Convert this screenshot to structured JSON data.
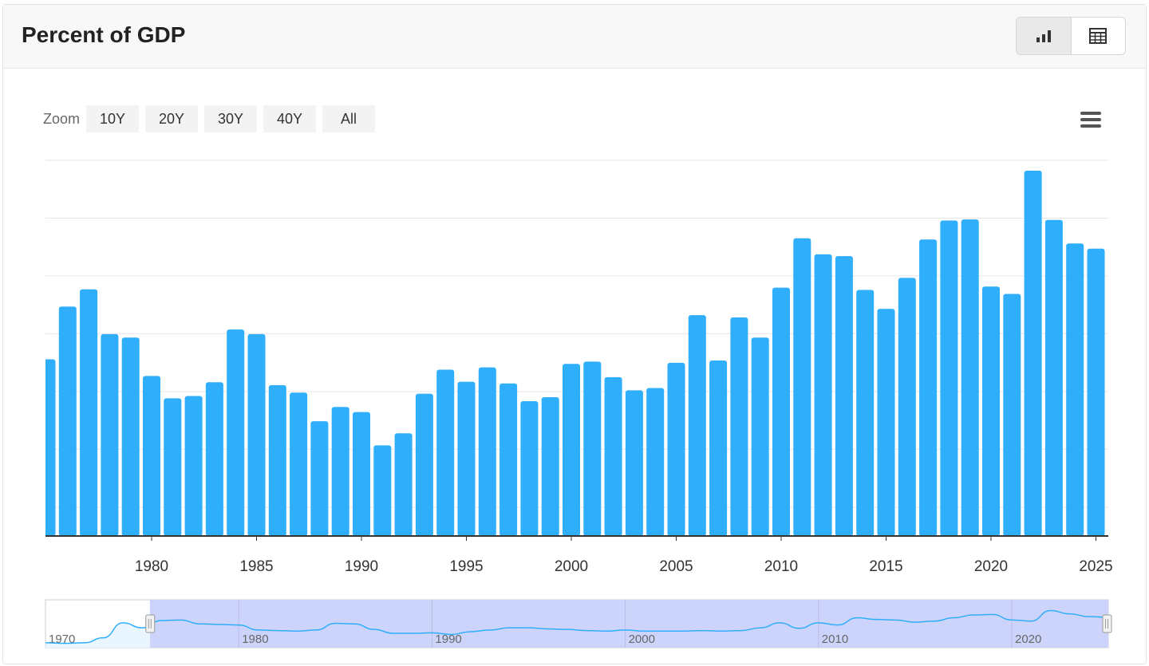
{
  "header": {
    "title": "Percent of GDP"
  },
  "view_toggle": {
    "chart_icon": "bar-chart-icon",
    "table_icon": "table-icon"
  },
  "zoom": {
    "label": "Zoom",
    "buttons": [
      "10Y",
      "20Y",
      "30Y",
      "40Y",
      "All"
    ]
  },
  "menu": {
    "icon": "hamburger-menu-icon"
  },
  "colors": {
    "bar": "#2eaefb",
    "navigator_fill": "#cdd4fb",
    "navigator_line": "#2eaefb",
    "grid": "#e6e6e6"
  },
  "chart_data": {
    "type": "bar",
    "title": "",
    "xlabel": "",
    "ylabel": "",
    "y_grid": true,
    "y_tick_labels_shown": false,
    "x": [
      1975,
      1976,
      1977,
      1978,
      1979,
      1980,
      1981,
      1982,
      1983,
      1984,
      1985,
      1986,
      1987,
      1988,
      1989,
      1990,
      1991,
      1992,
      1993,
      1994,
      1995,
      1996,
      1997,
      1998,
      1999,
      2000,
      2001,
      2002,
      2003,
      2004,
      2005,
      2006,
      2007,
      2008,
      2009,
      2010,
      2011,
      2012,
      2013,
      2014,
      2015,
      2016,
      2017,
      2018,
      2019,
      2020,
      2021,
      2022,
      2023,
      2024,
      2025
    ],
    "values": [
      3.08,
      4.0,
      4.3,
      3.52,
      3.46,
      2.79,
      2.4,
      2.44,
      2.68,
      3.6,
      3.52,
      2.63,
      2.5,
      2.0,
      2.25,
      2.16,
      1.58,
      1.79,
      2.48,
      2.9,
      2.69,
      2.94,
      2.66,
      2.35,
      2.42,
      3.0,
      3.04,
      2.77,
      2.54,
      2.58,
      3.02,
      3.85,
      3.06,
      3.81,
      3.46,
      4.33,
      5.19,
      4.91,
      4.88,
      4.29,
      3.96,
      4.5,
      5.17,
      5.5,
      5.52,
      4.35,
      4.22,
      6.37,
      5.51,
      5.1,
      5.01
    ],
    "ylim": [
      0,
      6.55
    ],
    "x_tick_labels": [
      "1980",
      "1985",
      "1990",
      "1995",
      "2000",
      "2005",
      "2010",
      "2015",
      "2020",
      "2025"
    ],
    "navigator": {
      "range_labels": [
        "1970",
        "1980",
        "1990",
        "2000",
        "2010",
        "2020"
      ],
      "x": [
        1970,
        1971,
        1972,
        1973,
        1974,
        1975,
        1976,
        1977,
        1978,
        1979,
        1980,
        1981,
        1982,
        1983,
        1984,
        1985,
        1986,
        1987,
        1988,
        1989,
        1990,
        1991,
        1992,
        1993,
        1994,
        1995,
        1996,
        1997,
        1998,
        1999,
        2000,
        2001,
        2002,
        2003,
        2004,
        2005,
        2006,
        2007,
        2008,
        2009,
        2010,
        2011,
        2012,
        2013,
        2014,
        2015,
        2016,
        2017,
        2018,
        2019,
        2020,
        2021,
        2022,
        2023,
        2024,
        2025
      ],
      "values": [
        0.3,
        0.2,
        0.3,
        1.2,
        3.9,
        3.0,
        4.3,
        4.4,
        3.7,
        3.6,
        3.5,
        2.6,
        2.5,
        2.4,
        2.6,
        3.8,
        3.7,
        2.7,
        2.0,
        2.0,
        2.1,
        1.8,
        2.3,
        2.6,
        3.0,
        3.0,
        2.8,
        2.7,
        2.5,
        2.4,
        2.6,
        2.4,
        2.4,
        2.4,
        2.5,
        2.4,
        2.5,
        3.0,
        3.9,
        2.9,
        3.9,
        3.5,
        4.8,
        4.5,
        4.4,
        4.0,
        4.2,
        4.8,
        5.3,
        5.4,
        4.4,
        4.2,
        6.1,
        5.5,
        5.0,
        4.9
      ],
      "selected_range": [
        1975,
        2025
      ]
    }
  }
}
